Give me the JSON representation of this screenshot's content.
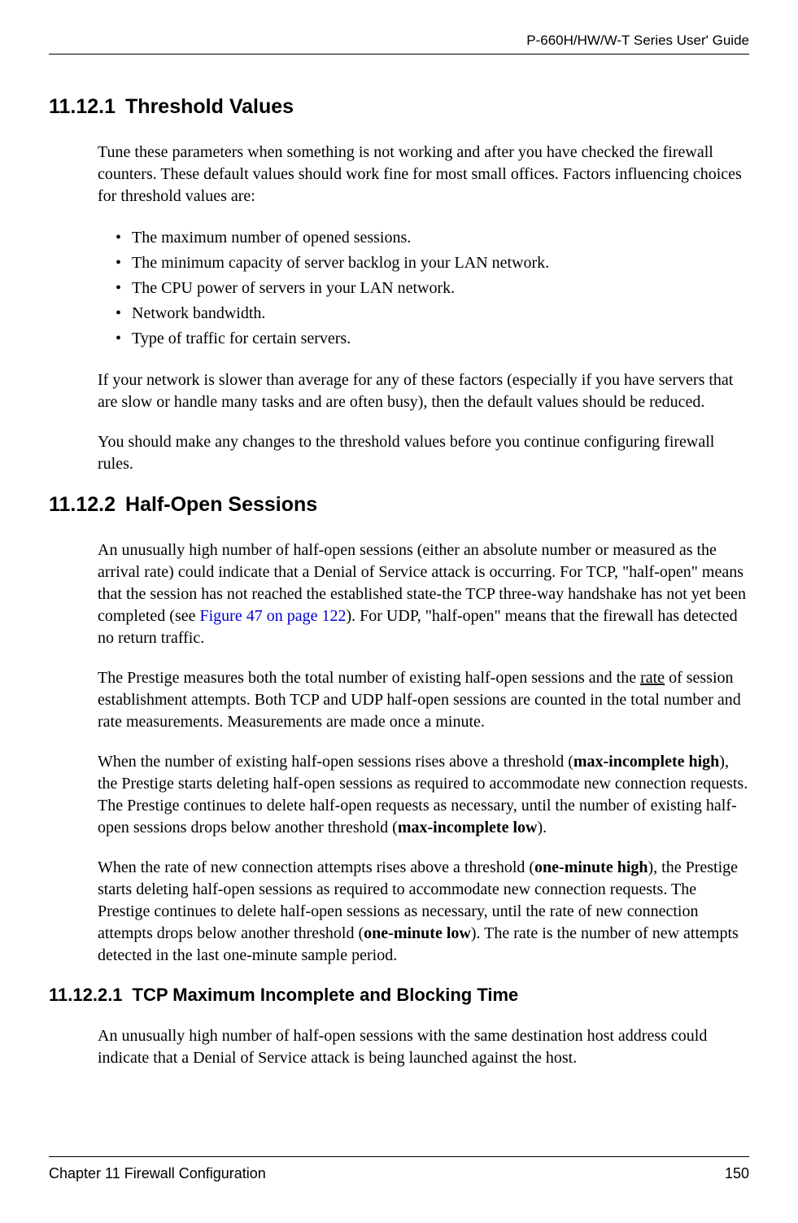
{
  "header": {
    "guide_title": "P-660H/HW/W-T Series User' Guide"
  },
  "sections": {
    "s1": {
      "number": "11.12.1",
      "title": "Threshold Values",
      "p1": "Tune these parameters when something is not working and after you have checked the firewall counters. These default values should work fine for most small offices. Factors influencing choices for threshold values are:",
      "bullets": [
        "The maximum number of opened sessions.",
        "The minimum capacity of server backlog in your LAN network.",
        "The CPU power of servers in your LAN network.",
        "Network bandwidth.",
        "Type of traffic for certain servers."
      ],
      "p2": "If your network is slower than average for any of these factors (especially if you have servers that are slow or handle many tasks and are often busy), then the default values should be reduced.",
      "p3": "You should make any changes to the threshold values before you continue configuring firewall rules."
    },
    "s2": {
      "number": "11.12.2",
      "title": "Half-Open Sessions",
      "p1a": "An unusually high number of half-open sessions (either an absolute number or measured as the arrival rate) could indicate that a Denial of Service attack is occurring. For TCP, \"half-open\" means that the session has not reached the established state-the TCP three-way handshake has not yet been completed (see ",
      "p1_xref": "Figure 47 on page 122",
      "p1b": "). For UDP, \"half-open\" means that the firewall has detected no return traffic.",
      "p2a": "The Prestige measures both the total number of existing half-open sessions and the ",
      "p2_rate": "rate",
      "p2b": " of session establishment attempts. Both TCP and UDP half-open sessions are counted in the total number and rate measurements. Measurements are made once a minute.",
      "p3a": "When the number of existing half-open sessions rises above a threshold (",
      "p3_b1": "max-incomplete high",
      "p3b": "), the Prestige starts deleting half-open sessions as required to accommodate new connection requests. The Prestige continues to delete half-open requests as necessary, until the number of existing half-open sessions drops below another threshold (",
      "p3_b2": "max-incomplete low",
      "p3c": ").",
      "p4a": "When the rate of new connection attempts rises above a threshold (",
      "p4_b1": "one-minute high",
      "p4b": "), the Prestige starts deleting half-open sessions as required to accommodate new connection requests. The Prestige continues to delete half-open sessions as necessary, until the rate of new connection attempts drops below another threshold (",
      "p4_b2": "one-minute low",
      "p4c": "). The rate is the number of new attempts detected in the last one-minute sample period."
    },
    "s3": {
      "number": "11.12.2.1",
      "title": "TCP Maximum Incomplete and Blocking Time",
      "p1": "An unusually high number of half-open sessions with the same destination host address could indicate that a Denial of Service attack is being launched against the host."
    }
  },
  "footer": {
    "chapter": "Chapter 11 Firewall Configuration",
    "page": "150"
  }
}
